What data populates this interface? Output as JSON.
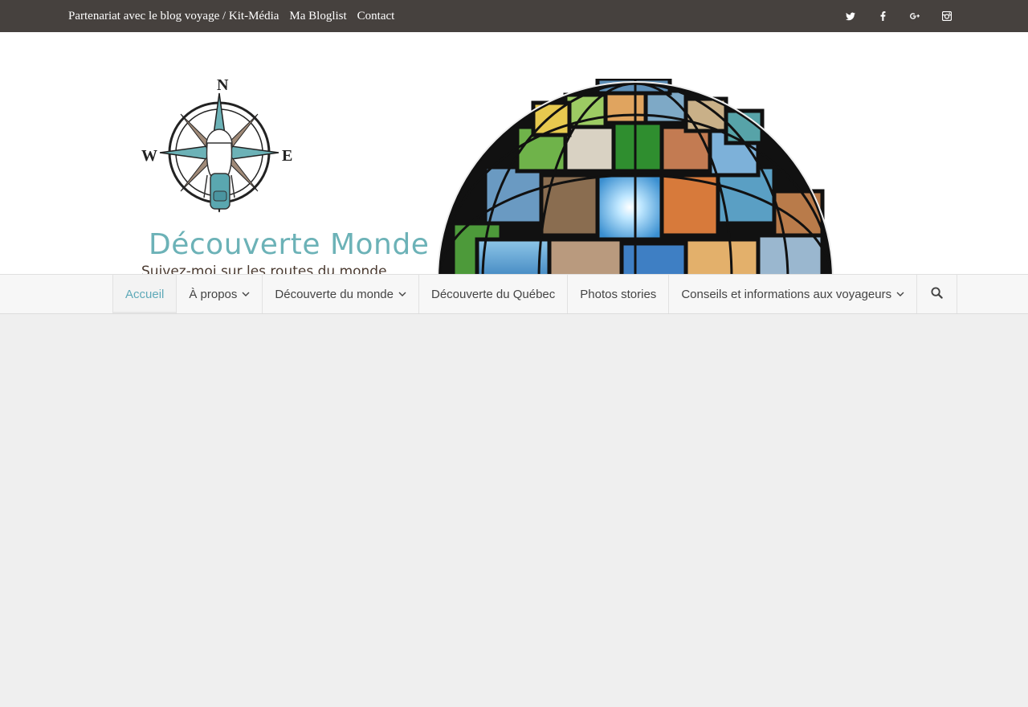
{
  "topbar": {
    "links": [
      "Partenariat avec le blog voyage / Kit-Média",
      "Ma Bloglist",
      "Contact"
    ],
    "social": [
      "twitter-icon",
      "facebook-icon",
      "google-plus-icon",
      "instagram-icon"
    ]
  },
  "header": {
    "logo_title": "Découverte Monde",
    "logo_tagline": "Suivez-moi sur les routes du monde",
    "compass_letters": {
      "north": "N",
      "west": "W",
      "east": "E"
    }
  },
  "nav": {
    "items": [
      {
        "label": "Accueil"
      },
      {
        "label": "À propos"
      },
      {
        "label": "Découverte du monde"
      },
      {
        "label": "Découverte du Québec"
      },
      {
        "label": "Photos stories"
      },
      {
        "label": "Conseils et informations aux voyageurs"
      }
    ],
    "search_icon": "search-icon"
  },
  "colors": {
    "topbar_bg": "#46413e",
    "accent": "#6cb2b7",
    "active_menu": "#5ea9b8",
    "page_bg": "#efefef"
  }
}
